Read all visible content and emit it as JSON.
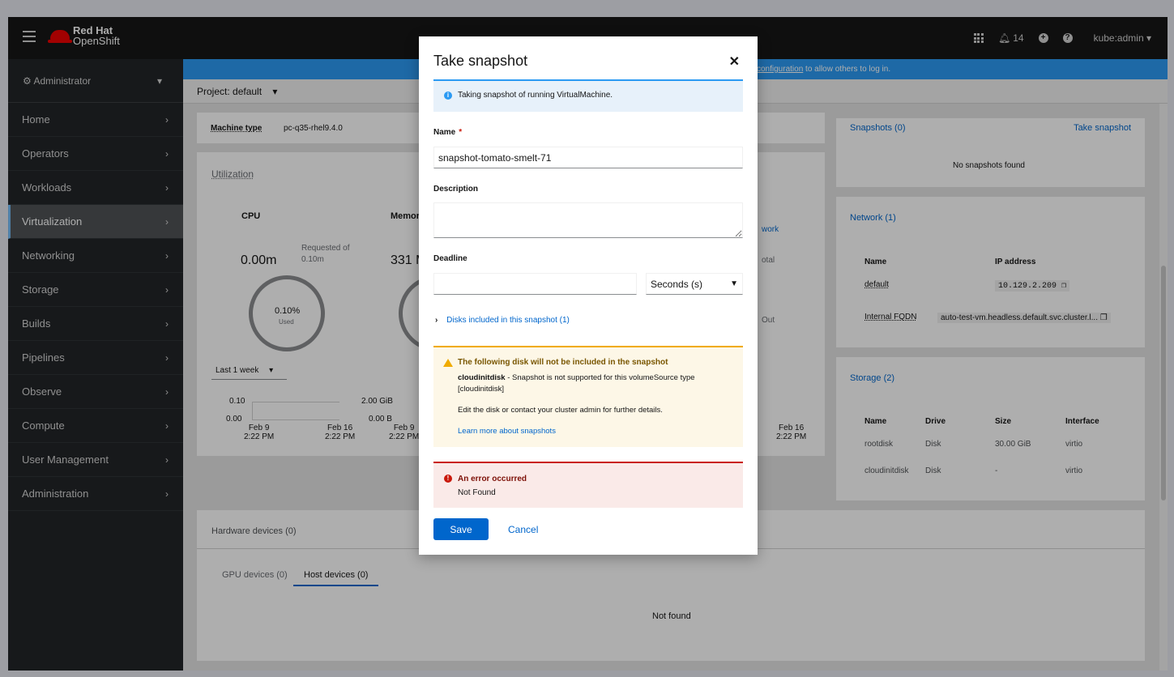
{
  "masthead": {
    "brand_line1": "Red Hat",
    "brand_line2": "OpenShift",
    "notifications_count": "14",
    "user": "kube:admin"
  },
  "sidebar": {
    "perspective": "Administrator",
    "items": [
      {
        "label": "Home"
      },
      {
        "label": "Operators"
      },
      {
        "label": "Workloads"
      },
      {
        "label": "Virtualization"
      },
      {
        "label": "Networking"
      },
      {
        "label": "Storage"
      },
      {
        "label": "Builds"
      },
      {
        "label": "Pipelines"
      },
      {
        "label": "Observe"
      },
      {
        "label": "Compute"
      },
      {
        "label": "User Management"
      },
      {
        "label": "Administration"
      }
    ],
    "active_index": 3
  },
  "banner": {
    "link": "configuration",
    "text": " to allow others to log in."
  },
  "project": {
    "label": "Project: default"
  },
  "background": {
    "machine_type_label": "Machine type",
    "machine_type_value": "pc-q35-rhel9.4.0",
    "utilization": "Utilization",
    "cpu": "CPU",
    "memory": "Memor",
    "cpu_value": "0.00m",
    "requested_of": "Requested of",
    "requested_value": "0.10m",
    "mem_value": "331 M",
    "donut_pct": "0.10%",
    "donut_used": "Used",
    "range": "Last 1 week",
    "cpu_y_hi": "0.10",
    "cpu_y_lo": "0.00",
    "mem_y_hi": "2.00 GiB",
    "mem_y_lo": "0.00 B",
    "x_feb9": "Feb 9",
    "x_feb16": "Feb 16",
    "x_time": "2:22 PM",
    "network_partial": "work",
    "total_partial": "otal",
    "out_partial": "Out",
    "snapshots_title": "Snapshots (0)",
    "take_snapshot_link": "Take snapshot",
    "no_snapshots": "No snapshots found",
    "network_title": "Network (1)",
    "net_col_name": "Name",
    "net_col_ip": "IP address",
    "net_name": "default",
    "net_ip": "10.129.2.209",
    "fqdn_label": "Internal FQDN",
    "fqdn_value": "auto-test-vm.headless.default.svc.cluster.l...",
    "storage_title": "Storage (2)",
    "st_cols": [
      "Name",
      "Drive",
      "Size",
      "Interface"
    ],
    "st_rows": [
      [
        "rootdisk",
        "Disk",
        "30.00 GiB",
        "virtio"
      ],
      [
        "cloudinitdisk",
        "Disk",
        "-",
        "virtio"
      ]
    ],
    "hw_title": "Hardware devices (0)",
    "tab_gpu": "GPU devices (0)",
    "tab_host": "Host devices (0)",
    "not_found": "Not found"
  },
  "modal": {
    "title": "Take snapshot",
    "info_alert": "Taking snapshot of running VirtualMachine.",
    "name_label": "Name",
    "name_value": "snapshot-tomato-smelt-71",
    "description_label": "Description",
    "description_value": "",
    "deadline_label": "Deadline",
    "deadline_value": "",
    "deadline_unit": "Seconds (s)",
    "disks_expander": "Disks included in this snapshot (1)",
    "warning_title": "The following disk will not be included in the snapshot",
    "warning_disk": "cloudinitdisk",
    "warning_disk_msg": " - Snapshot is not supported for this volumeSource type [cloudinitdisk]",
    "warning_hint": "Edit the disk or contact your cluster admin for further details.",
    "warning_link": "Learn more about snapshots",
    "error_title": "An error occurred",
    "error_msg": "Not Found",
    "save_label": "Save",
    "cancel_label": "Cancel"
  },
  "colors": {
    "primary": "#0066cc",
    "masthead": "#151515",
    "sidebar": "#212427",
    "banner": "#2b9af3",
    "warning": "#f0ab00",
    "danger": "#c9190b"
  }
}
